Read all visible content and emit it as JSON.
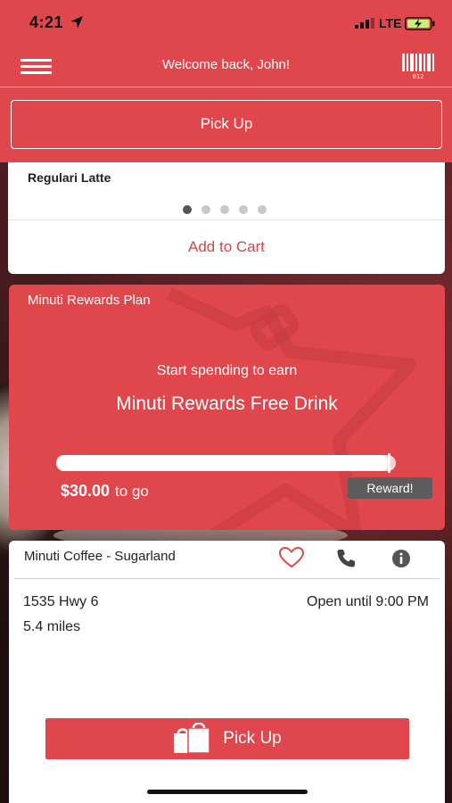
{
  "status_bar": {
    "time": "4:21",
    "network": "LTE",
    "icons": [
      "location-arrow-icon",
      "signal-bars-icon",
      "battery-charging-icon"
    ]
  },
  "header": {
    "title": "Welcome back, John!",
    "menu_icon": "hamburger-menu-icon",
    "barcode_icon": "barcode-icon",
    "barcode_number": "012"
  },
  "order_type": {
    "label": "Pick Up"
  },
  "product_card": {
    "name": "Regulari Latte",
    "carousel_pages": 5,
    "carousel_active_index": 0,
    "add_to_cart_label": "Add to Cart"
  },
  "rewards": {
    "plan_title": "Minuti Rewards Plan",
    "subtitle": "Start spending to earn",
    "headline": "Minuti Rewards Free Drink",
    "amount": "$30.00",
    "amount_suffix": "to go",
    "badge_label": "Reward!",
    "progress_fraction": 0.98
  },
  "location": {
    "store_name": "Minuti Coffee - Sugarland",
    "address": "1535 Hwy 6",
    "distance": "5.4 miles",
    "hours": "Open until 9:00 PM",
    "action_icons": [
      "heart-icon",
      "phone-icon",
      "info-icon"
    ],
    "pickup_button_label": "Pick Up"
  },
  "colors": {
    "brand_red": "#e0474c",
    "accent_text_red": "#d9434a",
    "badge_gray": "#5c5c5c",
    "white": "#ffffff"
  }
}
